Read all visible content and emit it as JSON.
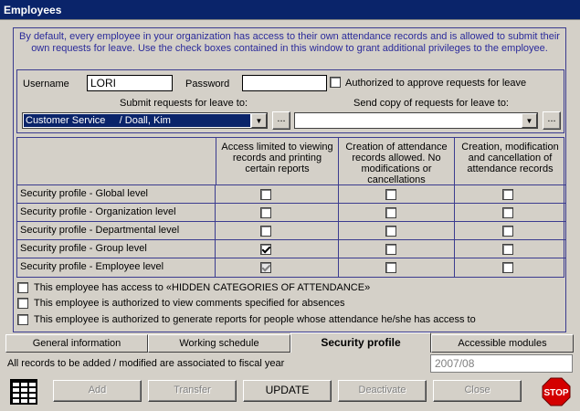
{
  "window": {
    "title": "Employees"
  },
  "intro_text": "By default, every employee in your organization has access to their own attendance records and is allowed to submit their own requests for leave. Use the check boxes contained in this window to grant additional privileges to the employee.",
  "credentials": {
    "username_label": "Username",
    "username_value": "LORI",
    "password_label": "Password",
    "password_value": "",
    "approve_label": "Authorized to approve requests for leave",
    "approve_checked": false,
    "submit_label": "Submit requests for leave to:",
    "submit_value": "Customer Service     / Doall, Kim",
    "copy_label": "Send copy of requests for leave to:",
    "copy_value": "",
    "browse_label": "..."
  },
  "security_grid": {
    "columns": [
      "Access limited to viewing records and printing certain reports",
      "Creation of attendance records allowed. No modifications or cancellations",
      "Creation, modification and cancellation of attendance records"
    ],
    "rows": [
      {
        "label": "Security profile  -  Global level",
        "checks": [
          false,
          false,
          false
        ],
        "disabled": [
          false,
          false,
          false
        ]
      },
      {
        "label": "Security profile  -  Organization level",
        "checks": [
          false,
          false,
          false
        ],
        "disabled": [
          false,
          false,
          false
        ]
      },
      {
        "label": "Security profile  -  Departmental level",
        "checks": [
          false,
          false,
          false
        ],
        "disabled": [
          false,
          false,
          false
        ]
      },
      {
        "label": "Security profile  -  Group level",
        "checks": [
          true,
          false,
          false
        ],
        "disabled": [
          false,
          false,
          false
        ]
      },
      {
        "label": "Security profile  -  Employee level",
        "checks": [
          true,
          false,
          false
        ],
        "disabled": [
          true,
          false,
          false
        ]
      }
    ]
  },
  "options": [
    {
      "label": "This employee has access to «HIDDEN CATEGORIES OF ATTENDANCE»",
      "checked": false
    },
    {
      "label": "This employee is authorized to view comments specified for absences",
      "checked": false
    },
    {
      "label": "This employee is authorized to generate reports for people whose attendance he/she has access to",
      "checked": false
    }
  ],
  "tabs": [
    {
      "label": "General information",
      "active": false
    },
    {
      "label": "Working schedule",
      "active": false
    },
    {
      "label": "Security profile",
      "active": true
    },
    {
      "label": "Accessible modules",
      "active": false
    }
  ],
  "fiscal": {
    "label": "All records to be added / modified are associated to fiscal year",
    "value": "2007/08"
  },
  "buttons": [
    {
      "label": "Add",
      "enabled": false
    },
    {
      "label": "Transfer",
      "enabled": false
    },
    {
      "label": "UPDATE",
      "enabled": true
    },
    {
      "label": "Deactivate",
      "enabled": false
    },
    {
      "label": "Close",
      "enabled": false
    }
  ],
  "icons": {
    "left": "grid-icon",
    "right": "stop-icon",
    "stop_text": "STOP"
  },
  "colors": {
    "title_bar": "#0a246a",
    "frame": "#3b3c8f",
    "intro_text": "#2a2a9a",
    "stop_red": "#d40000"
  }
}
